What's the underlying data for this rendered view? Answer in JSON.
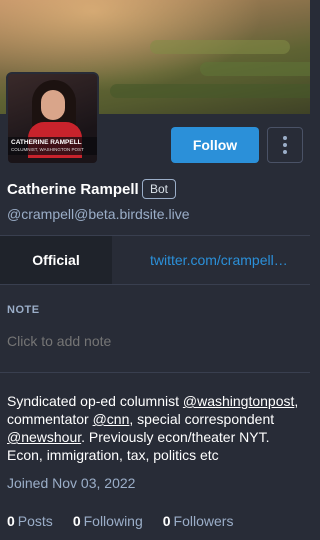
{
  "profile": {
    "display_name": "Catherine Rampell",
    "badge": "Bot",
    "handle": "@crampell@beta.birdsite.live",
    "avatar_caption_line1": "CATHERINE RAMPELL",
    "avatar_caption_line2": "COLUMNIST, WASHINGTON POST"
  },
  "actions": {
    "follow_label": "Follow",
    "menu_icon": "kebab-menu-icon"
  },
  "field": {
    "name": "Official",
    "value": "twitter.com/crampell…"
  },
  "note": {
    "label": "NOTE",
    "placeholder": "Click to add note"
  },
  "bio": {
    "part1": "Syndicated op-ed columnist ",
    "mention1": "@washingtonpost",
    "part2": ", commentator ",
    "mention2": "@cnn",
    "part3": ", special correspondent ",
    "mention3": "@newshour",
    "part4": ". Previously econ/theater NYT. Econ, immigration, tax, politics etc"
  },
  "joined": "Joined Nov 03, 2022",
  "stats": {
    "posts_count": "0",
    "posts_label": "Posts",
    "following_count": "0",
    "following_label": "Following",
    "followers_count": "0",
    "followers_label": "Followers"
  },
  "colors": {
    "background": "#282c37",
    "accent": "#2b90d9",
    "muted": "#9baec8"
  }
}
